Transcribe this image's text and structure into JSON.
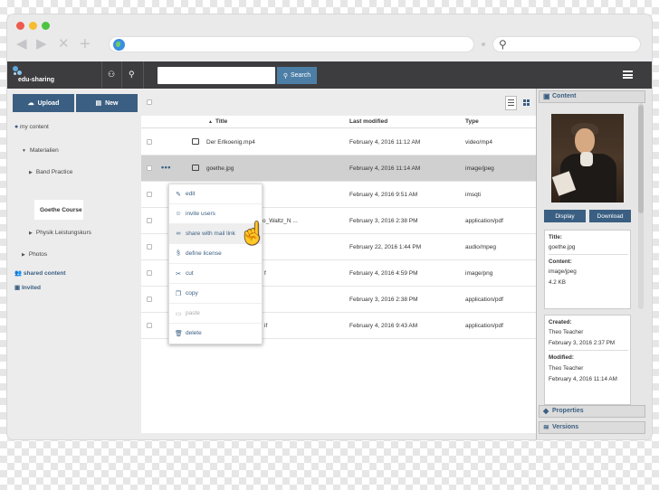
{
  "browser": {
    "nav_back": "◀",
    "nav_forward": "▶",
    "nav_close": "✕",
    "nav_add": "+"
  },
  "app": {
    "logo_text": "edu-sharing",
    "search_button": "Search",
    "search_placeholder": ""
  },
  "sidebar": {
    "upload_label": "Upload",
    "new_label": "New",
    "my_content": "my content",
    "materialien": "Materialien",
    "band_practice": "Band Practice",
    "goethe_course": "Goethe Course",
    "physik": "Physik Leistungskurs",
    "photos": "Photos",
    "shared_content": "shared content",
    "invited": "Invited"
  },
  "table": {
    "col_title": "Title",
    "col_modified": "Last modified",
    "col_type": "Type",
    "rows": [
      {
        "title": "Der Erlkoenig.mp4",
        "modified": "February 4, 2016 11:12 AM",
        "type": "video/mp4"
      },
      {
        "title": "goethe.jpg",
        "modified": "February 4, 2016 11:14 AM",
        "type": "image/jpeg"
      },
      {
        "title": "",
        "modified": "February 4, 2016 9:51 AM",
        "type": "imsqti"
      },
      {
        "title": "o_Waltz_N ...",
        "modified": "February 3, 2016 2:38 PM",
        "type": "application/pdf"
      },
      {
        "title": "",
        "modified": "February 22, 2016 1:44 PM",
        "type": "audio/mpeg"
      },
      {
        "title": "f",
        "modified": "February 4, 2016 4:59 PM",
        "type": "image/png"
      },
      {
        "title": "",
        "modified": "February 3, 2016 2:38 PM",
        "type": "application/pdf"
      },
      {
        "title": "if",
        "modified": "February 4, 2016 9:43 AM",
        "type": "application/pdf"
      }
    ]
  },
  "context_menu": {
    "edit": "edit",
    "invite_users": "invite users",
    "share_mail": "share with mail link",
    "define_license": "define license",
    "cut": "cut",
    "copy": "copy",
    "paste": "paste",
    "delete": "delete"
  },
  "panel": {
    "content_header": "Content",
    "display_button": "Display",
    "download_button": "Download",
    "title_label": "Title:",
    "title_value": "goethe.jpg",
    "content_label": "Content:",
    "content_type": "image/jpeg",
    "content_size": "4.2 KB",
    "created_label": "Created:",
    "created_by": "Theo Teacher",
    "created_date": "February 3, 2016 2:37 PM",
    "modified_label": "Modified:",
    "modified_by": "Theo Teacher",
    "modified_date": "February 4, 2016 11:14 AM",
    "properties_header": "Properties",
    "versions_header": "Versions"
  },
  "colors": {
    "accent": "#3a5f82",
    "header_bg": "#3d3d40",
    "search_btn": "#4d7fa6"
  }
}
